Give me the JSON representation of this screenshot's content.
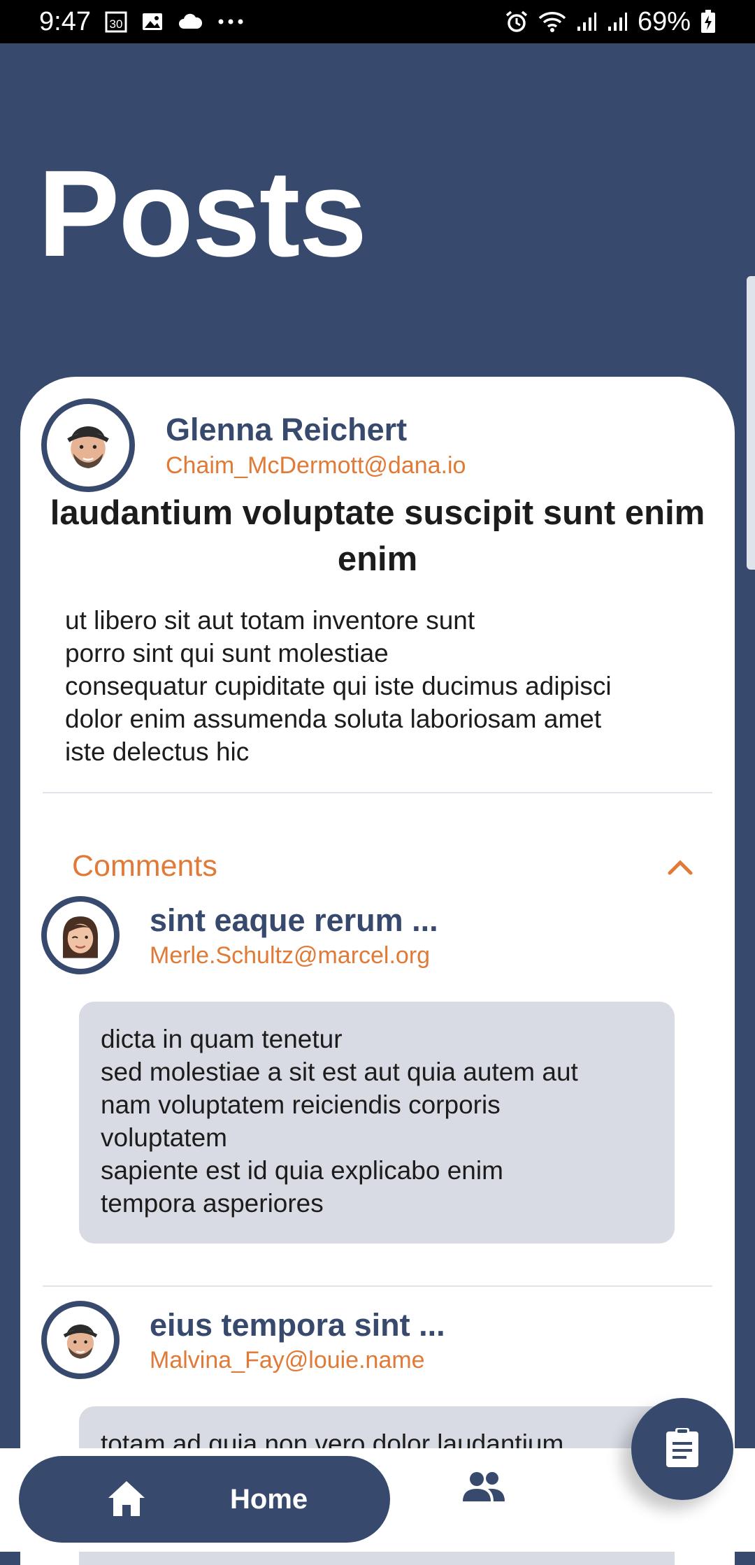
{
  "status_bar": {
    "time": "9:47",
    "battery": "69%",
    "icons": [
      "calendar-30-icon",
      "image-icon",
      "cloud-icon",
      "more-dots-icon",
      "alarm-icon",
      "wifi-icon",
      "signal-icon",
      "signal-icon",
      "battery-charging-icon"
    ]
  },
  "header": {
    "title": "Posts"
  },
  "post": {
    "author_name": "Glenna Reichert",
    "author_email": "Chaim_McDermott@dana.io",
    "title": "laudantium voluptate suscipit sunt enim enim",
    "body": "ut libero sit aut totam inventore sunt\nporro sint qui sunt molestiae\nconsequatur cupiditate qui iste ducimus adipisci\ndolor enim assumenda soluta laboriosam amet\niste delectus hic"
  },
  "comments": {
    "label": "Comments",
    "items": [
      {
        "name": "sint eaque rerum ...",
        "email": "Merle.Schultz@marcel.org",
        "body": "dicta in quam tenetur\nsed molestiae a sit est aut quia autem aut\nnam voluptatem reiciendis corporis\nvoluptatem\nsapiente est id quia explicabo enim\ntempora asperiores"
      },
      {
        "name": "eius tempora sint ...",
        "email": "Malvina_Fay@louie.name",
        "body": "totam ad quia non vero dolor laudantium"
      }
    ]
  },
  "bottom_nav": {
    "home_label": "Home",
    "items": [
      "home-icon",
      "people-icon"
    ]
  },
  "fab": {
    "icon": "clipboard-icon"
  },
  "colors": {
    "primary": "#374a6e",
    "accent": "#e07a36",
    "bubble": "#d8dbe3",
    "card": "#ffffff"
  }
}
